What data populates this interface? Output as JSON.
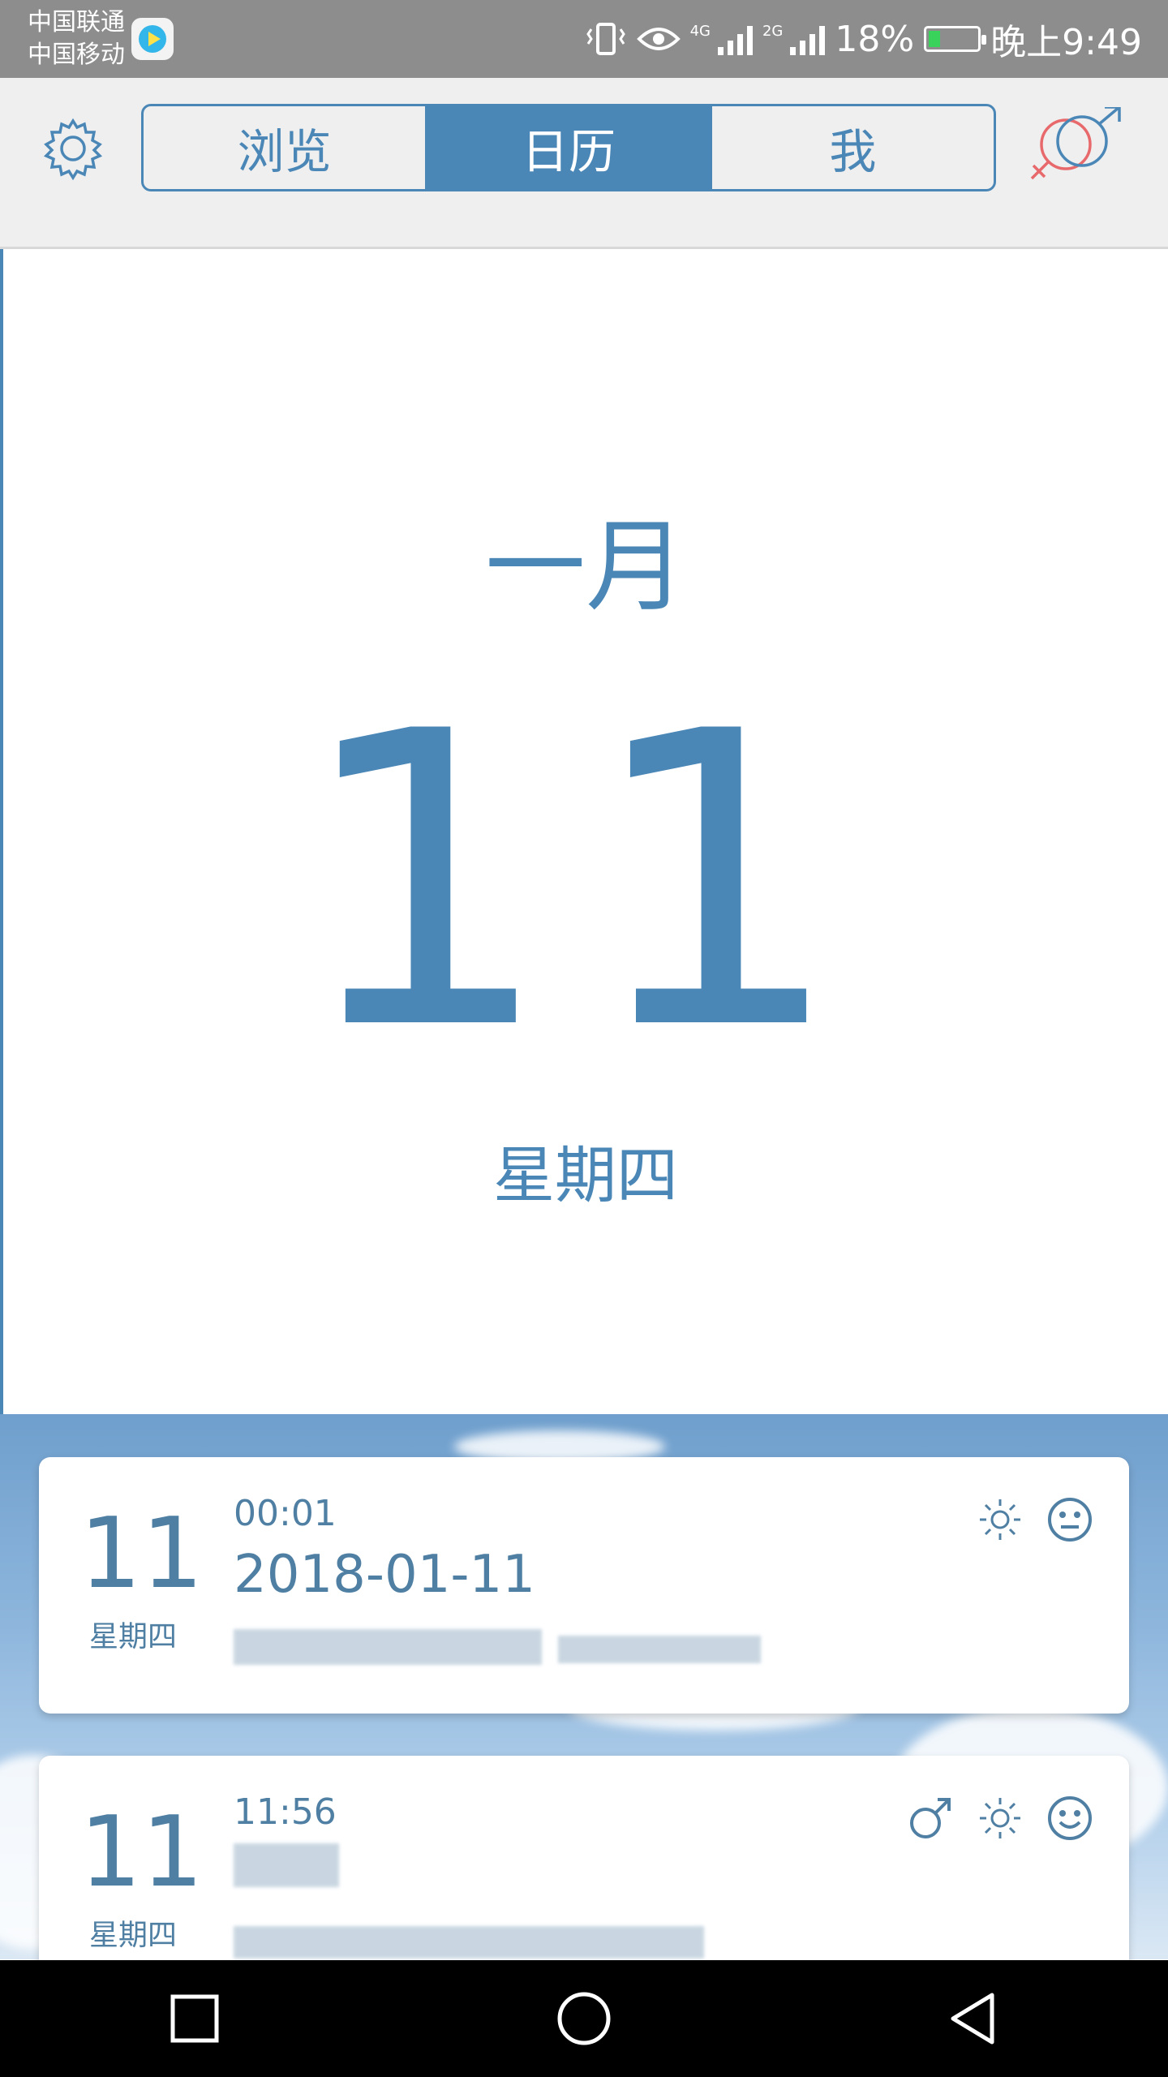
{
  "status_bar": {
    "carrier1": "中国联通",
    "carrier2": "中国移动",
    "net1": "4G",
    "net2": "2G",
    "battery": "18%",
    "time": "晚上9:49"
  },
  "header": {
    "tabs": [
      {
        "label": "浏览",
        "active": false
      },
      {
        "label": "日历",
        "active": true
      },
      {
        "label": "我",
        "active": false
      }
    ]
  },
  "date_panel": {
    "month": "一月",
    "day": "11",
    "weekday": "星期四"
  },
  "entries": [
    {
      "day": "11",
      "weekday": "星期四",
      "time": "00:01",
      "title": "2018-01-11",
      "icons": [
        "sun-icon",
        "neutral-face-icon"
      ]
    },
    {
      "day": "11",
      "weekday": "星期四",
      "time": "11:56",
      "title": "",
      "icons": [
        "male-icon",
        "sun-icon",
        "smile-face-icon"
      ]
    }
  ],
  "colors": {
    "accent": "#4a87b7",
    "card_text": "#4f7fa3"
  }
}
